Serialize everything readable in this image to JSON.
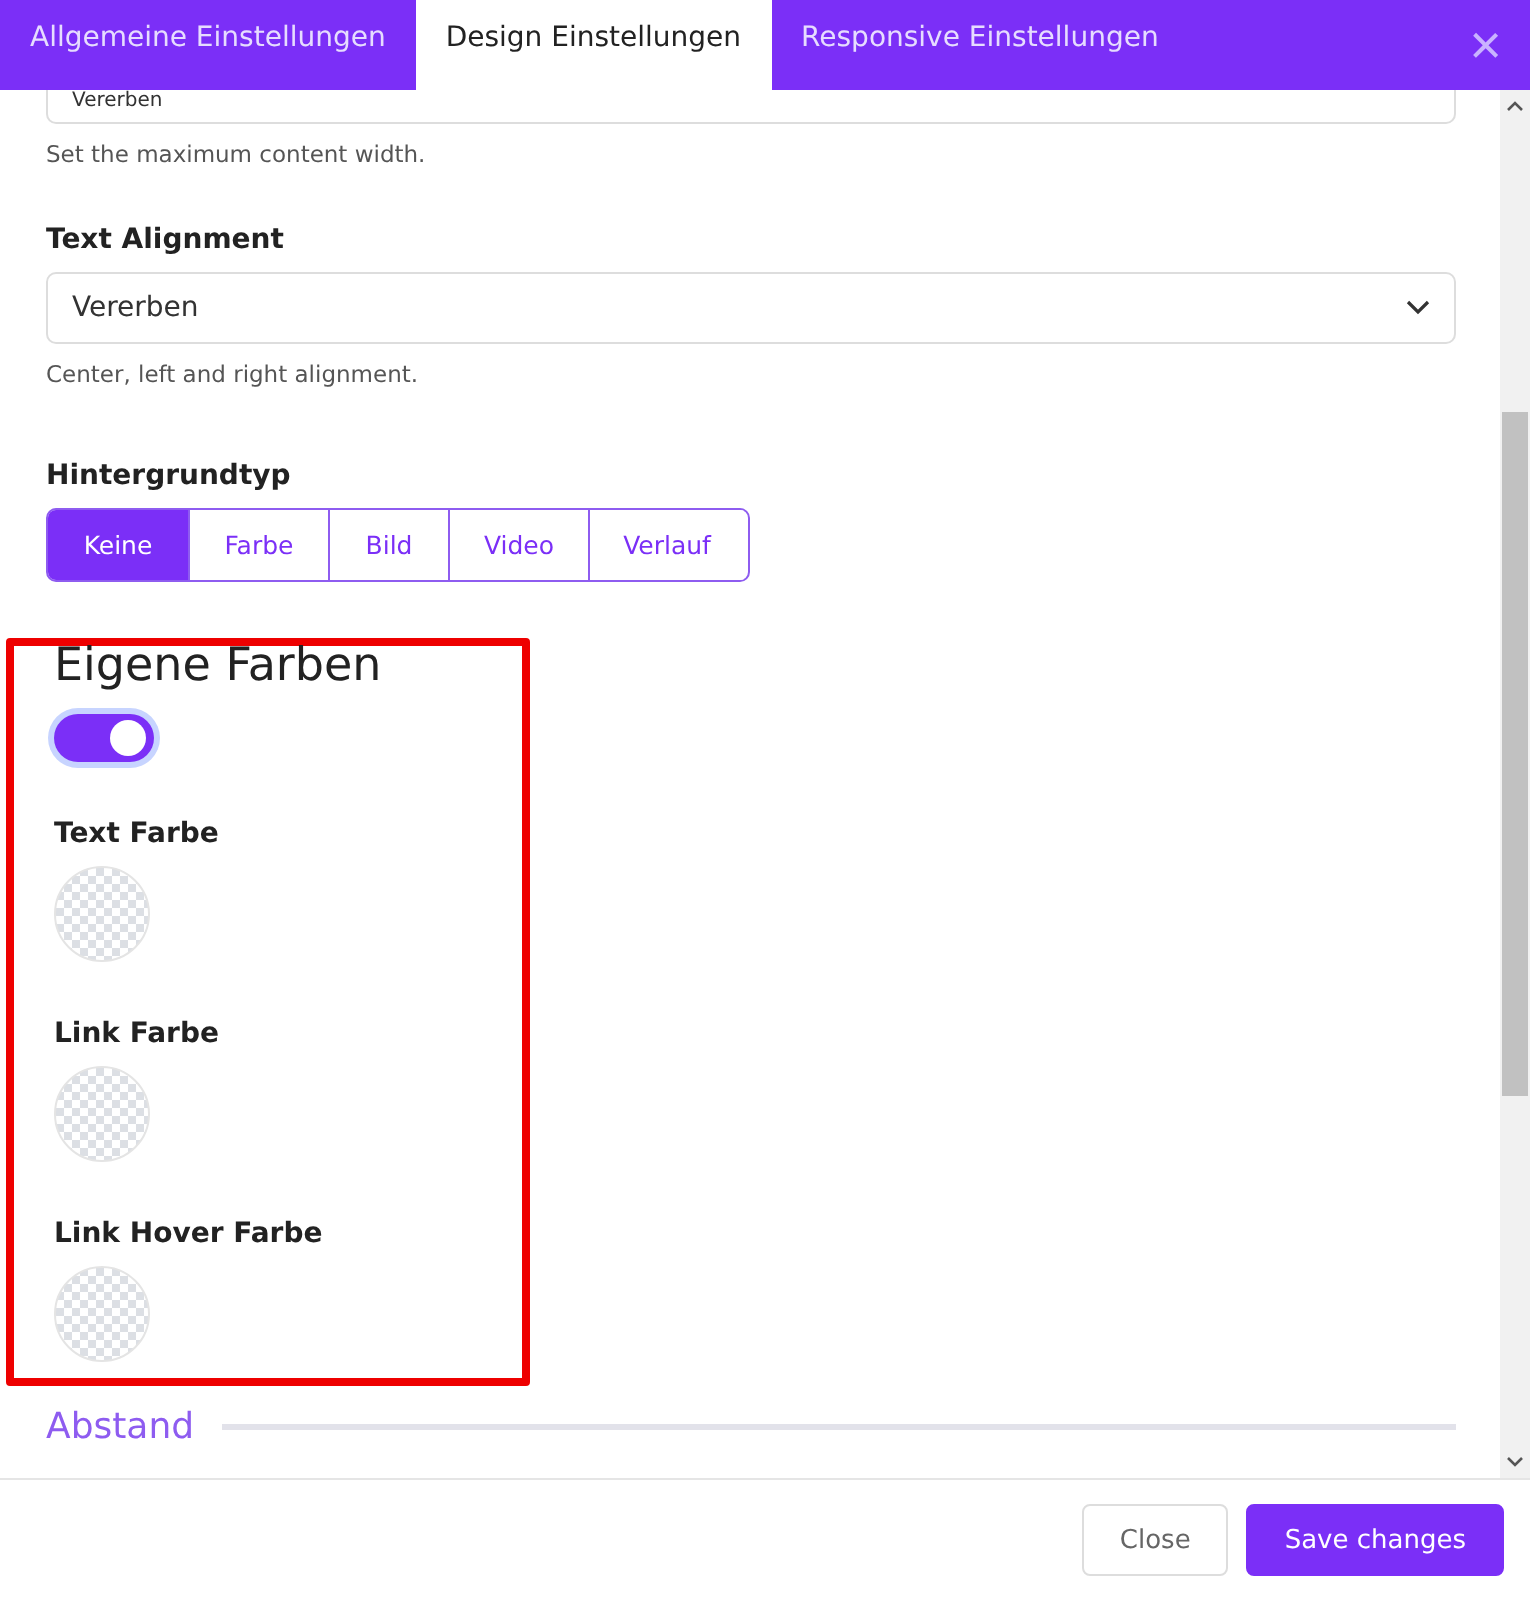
{
  "tabs": [
    {
      "label": "Allgemeine Einstellungen",
      "selected": false
    },
    {
      "label": "Design Einstellungen",
      "selected": true
    },
    {
      "label": "Responsive Einstellungen",
      "selected": false
    }
  ],
  "close_icon": "×",
  "width_field": {
    "value": "Vererben",
    "help": "Set the maximum content width."
  },
  "text_alignment": {
    "label": "Text Alignment",
    "value": "Vererben",
    "help": "Center, left and right alignment."
  },
  "background_type": {
    "label": "Hintergrundtyp",
    "options": [
      {
        "label": "Keine",
        "selected": true
      },
      {
        "label": "Farbe",
        "selected": false
      },
      {
        "label": "Bild",
        "selected": false
      },
      {
        "label": "Video",
        "selected": false
      },
      {
        "label": "Verlauf",
        "selected": false
      }
    ]
  },
  "custom_colors": {
    "title": "Eigene Farben",
    "highlighted": true,
    "on": true,
    "colors": [
      {
        "label": "Text Farbe"
      },
      {
        "label": "Link Farbe"
      },
      {
        "label": "Link Hover Farbe"
      }
    ]
  },
  "next_section": "Abstand",
  "buttons": [
    {
      "label": "Close",
      "kind": "secondary"
    },
    {
      "label": "Save changes",
      "kind": "primary"
    }
  ]
}
